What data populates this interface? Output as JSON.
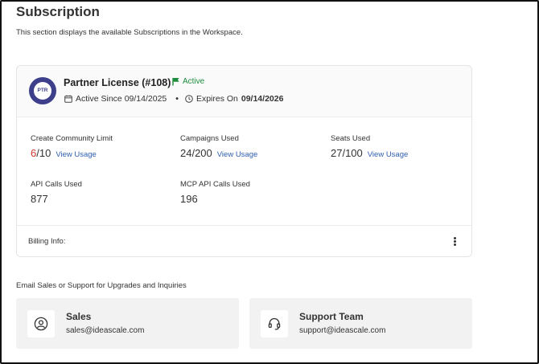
{
  "page": {
    "title": "Subscription",
    "description": "This section displays the available Subscriptions in the Workspace."
  },
  "license": {
    "logo_text": "PTR",
    "name": "Partner License (#108)",
    "status": "Active",
    "active_since_label": "Active Since 09/14/2025",
    "bullet": "•",
    "expires_label": "Expires On",
    "expires_date": "09/14/2026",
    "status_color": "#1e8c3e",
    "logo_color": "#3d3f8a"
  },
  "metrics": {
    "community": {
      "label": "Create Community Limit",
      "used": "6",
      "total": "/10",
      "link": "View Usage"
    },
    "campaigns": {
      "label": "Campaigns Used",
      "value": "24/200",
      "link": "View Usage"
    },
    "seats": {
      "label": "Seats Used",
      "value": "27/100",
      "link": "View Usage"
    },
    "api": {
      "label": "API Calls Used",
      "value": "877"
    },
    "mcp": {
      "label": "MCP API Calls Used",
      "value": "196"
    }
  },
  "billing": {
    "label": "Billing Info:",
    "menu_icon": "kebab-menu-icon"
  },
  "contacts": {
    "heading": "Email Sales or Support for Upgrades and Inquiries",
    "sales": {
      "title": "Sales",
      "email": "sales@ideascale.com",
      "icon": "user-circle-icon"
    },
    "support": {
      "title": "Support Team",
      "email": "support@ideascale.com",
      "icon": "headset-icon"
    }
  }
}
